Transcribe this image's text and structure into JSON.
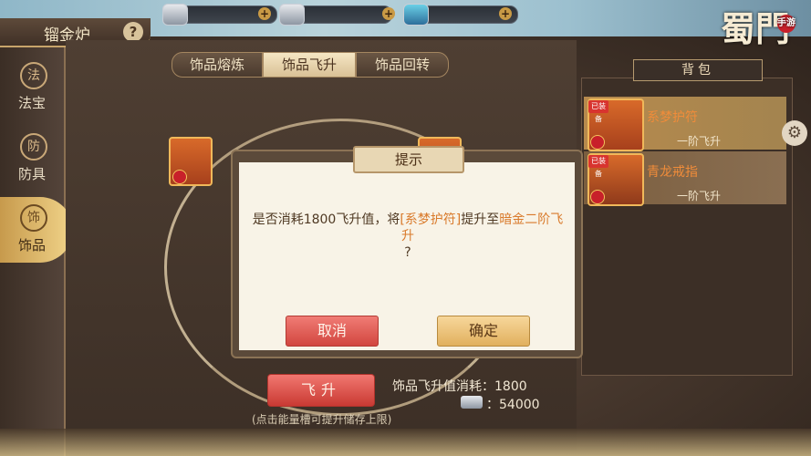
{
  "window": {
    "title": "镏金炉",
    "help": "?"
  },
  "currency": [
    {
      "icon": "silver-ingot-icon",
      "plus": "+"
    },
    {
      "icon": "lock-ingot-icon",
      "plus": "+"
    },
    {
      "icon": "crystal-icon",
      "plus": "+"
    }
  ],
  "leftnav": [
    {
      "label": "法宝",
      "icon": "法"
    },
    {
      "label": "防具",
      "icon": "防"
    },
    {
      "label": "饰品",
      "icon": "饰"
    }
  ],
  "tabs": [
    "饰品熔炼",
    "饰品飞升",
    "饰品回转"
  ],
  "dialog": {
    "title": "提示",
    "msg_prefix": "是否消耗1800飞升值，将",
    "msg_item": "[系梦护符]",
    "msg_mid": "提升至",
    "msg_target": "暗金二阶飞升",
    "msg_end": "?",
    "cancel": "取消",
    "ok": "确定"
  },
  "fly_button": "飞升",
  "cost": {
    "label": "饰品飞升值消耗：1800",
    "silver": "：54000"
  },
  "hint": "(点击能量槽可提升储存上限)",
  "bag": {
    "title": "背包",
    "items": [
      {
        "name": "系梦护符",
        "level": "一阶飞升",
        "tag": "已装备"
      },
      {
        "name": "青龙戒指",
        "level": "一阶飞升",
        "tag": "已装备"
      }
    ]
  },
  "logo": {
    "main": "蜀門",
    "sub": "手游"
  },
  "colors": {
    "highlight": "#d97a2b",
    "cancel": "#d2463f",
    "ok": "#e1b05e"
  }
}
